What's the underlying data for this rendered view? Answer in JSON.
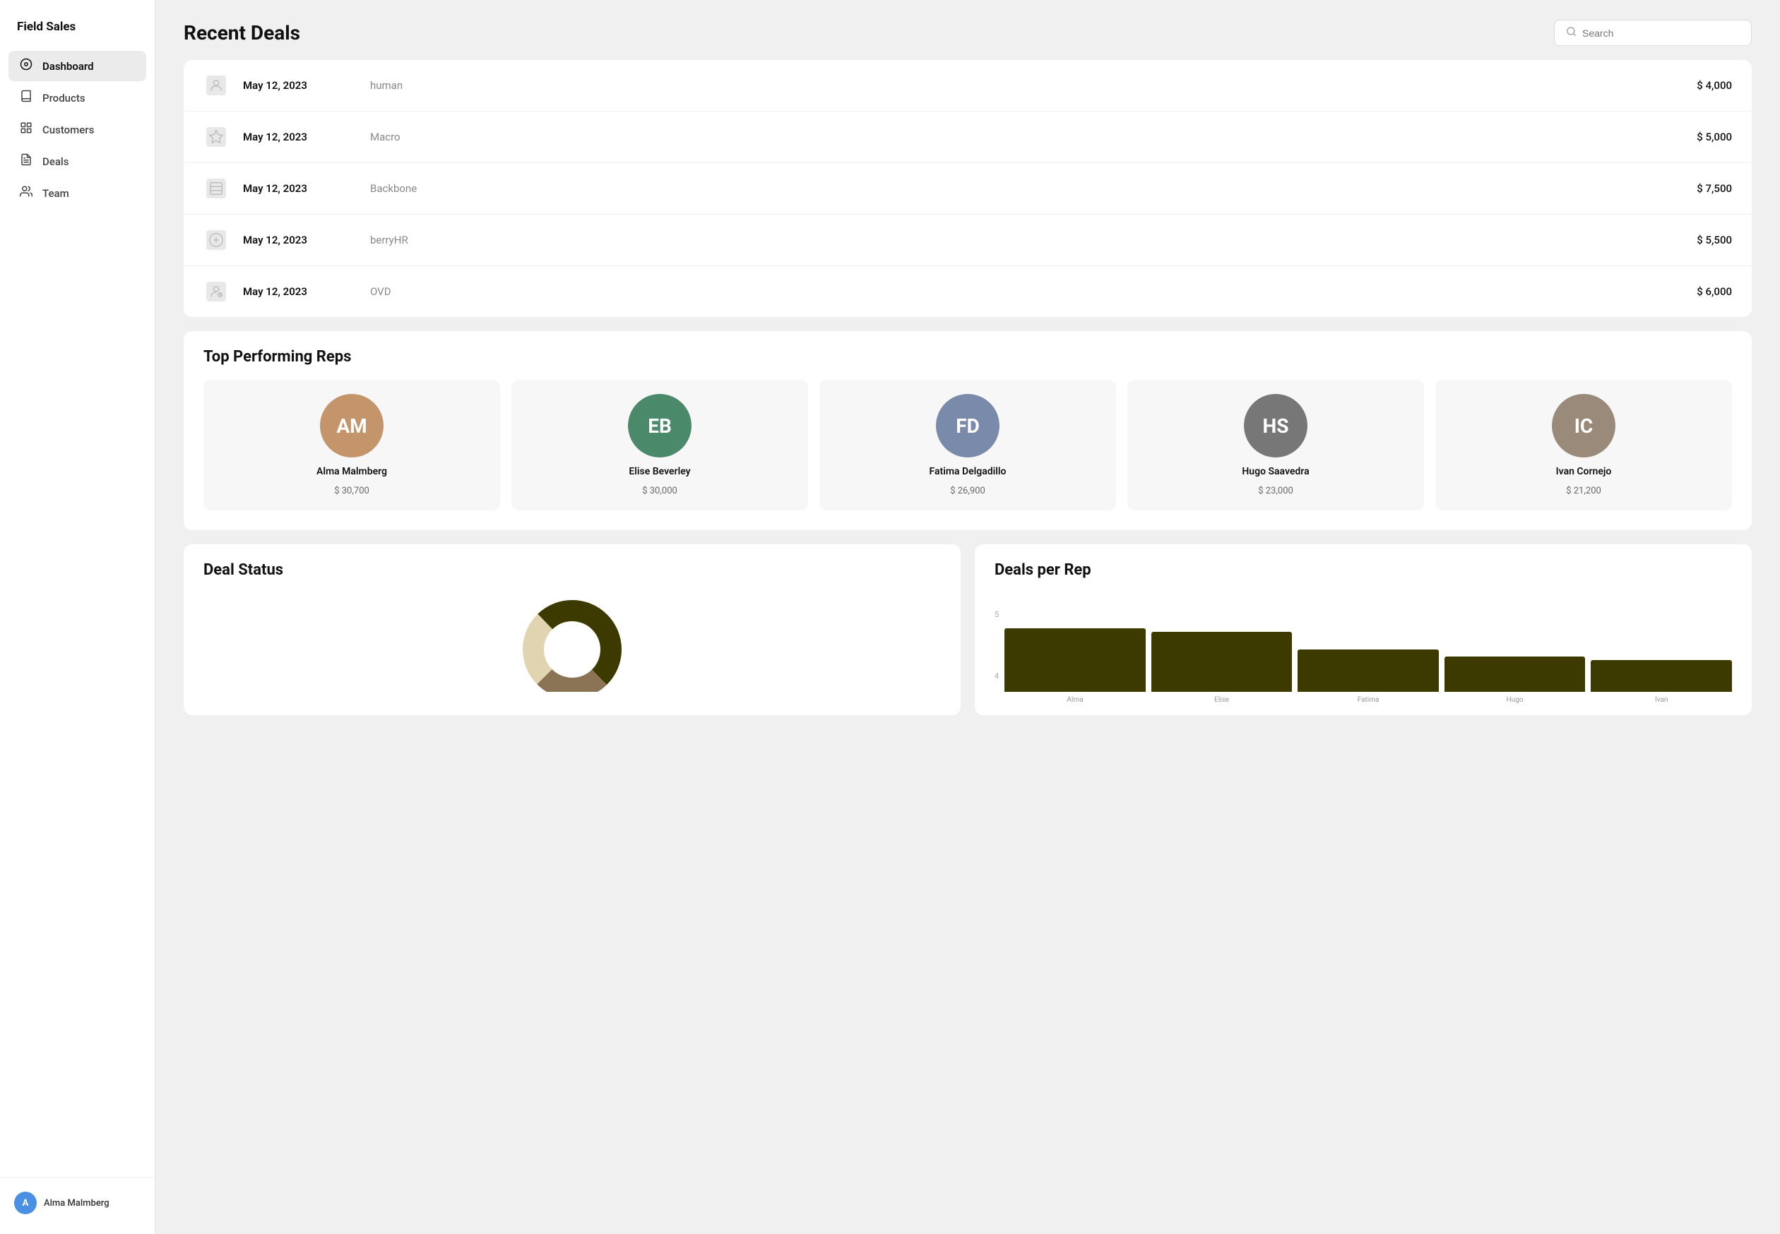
{
  "app": {
    "title": "Field Sales"
  },
  "sidebar": {
    "items": [
      {
        "id": "dashboard",
        "label": "Dashboard",
        "icon": "dashboard-icon",
        "active": true
      },
      {
        "id": "products",
        "label": "Products",
        "icon": "products-icon",
        "active": false
      },
      {
        "id": "customers",
        "label": "Customers",
        "icon": "customers-icon",
        "active": false
      },
      {
        "id": "deals",
        "label": "Deals",
        "icon": "deals-icon",
        "active": false
      },
      {
        "id": "team",
        "label": "Team",
        "icon": "team-icon",
        "active": false
      }
    ],
    "user": {
      "name": "Alma Malmberg",
      "initial": "A"
    }
  },
  "header": {
    "title": "Recent Deals",
    "search_placeholder": "Search"
  },
  "recent_deals": {
    "rows": [
      {
        "date": "May 12, 2023",
        "company": "human",
        "amount": "$ 4,000"
      },
      {
        "date": "May 12, 2023",
        "company": "Macro",
        "amount": "$ 5,000"
      },
      {
        "date": "May 12, 2023",
        "company": "Backbone",
        "amount": "$ 7,500"
      },
      {
        "date": "May 12, 2023",
        "company": "berryHR",
        "amount": "$ 5,500"
      },
      {
        "date": "May 12, 2023",
        "company": "OVD",
        "amount": "$ 6,000"
      }
    ]
  },
  "top_reps": {
    "section_title": "Top Performing Reps",
    "reps": [
      {
        "name": "Alma Malmberg",
        "amount": "$ 30,700",
        "color": "#c4956a",
        "initial": "AM"
      },
      {
        "name": "Elise Beverley",
        "amount": "$ 30,000",
        "color": "#5a8a6a",
        "initial": "EB"
      },
      {
        "name": "Fatima Delgadillo",
        "amount": "$ 26,900",
        "color": "#7a8aaa",
        "initial": "FD"
      },
      {
        "name": "Hugo Saavedra",
        "amount": "$ 23,000",
        "color": "#888",
        "initial": "HS"
      },
      {
        "name": "Ivan Cornejo",
        "amount": "$ 21,200",
        "color": "#9a8a7a",
        "initial": "IC"
      }
    ]
  },
  "deal_status": {
    "section_title": "Deal Status"
  },
  "deals_per_rep": {
    "section_title": "Deals per Rep",
    "y_labels": [
      "5",
      "4"
    ],
    "bars": [
      {
        "height": 90,
        "label": "Alma"
      },
      {
        "height": 85,
        "label": "Elise"
      },
      {
        "height": 60,
        "label": "Fatima"
      },
      {
        "height": 50,
        "label": "Hugo"
      },
      {
        "height": 45,
        "label": "Ivan"
      }
    ]
  }
}
